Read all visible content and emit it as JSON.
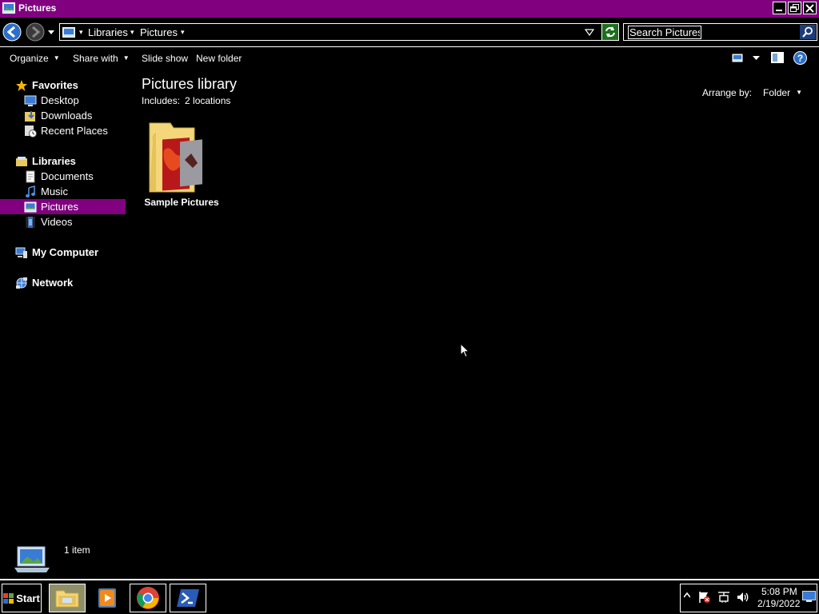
{
  "window": {
    "title": "Pictures",
    "controls": [
      "minimize-icon",
      "restore-icon",
      "close-icon"
    ]
  },
  "address_bar": {
    "breadcrumbs": [
      "Libraries",
      "Pictures"
    ],
    "refresh_icon": "refresh-icon"
  },
  "search": {
    "placeholder": "Search Pictures"
  },
  "command_bar": {
    "organize": "Organize",
    "share_with": "Share with",
    "slide_show": "Slide show",
    "new_folder": "New folder"
  },
  "nav": {
    "favorites": {
      "label": "Favorites",
      "items": [
        "Desktop",
        "Downloads",
        "Recent Places"
      ]
    },
    "libraries": {
      "label": "Libraries",
      "items": [
        "Documents",
        "Music",
        "Pictures",
        "Videos"
      ],
      "selected": "Pictures"
    },
    "computer": "My Computer",
    "network": "Network"
  },
  "content": {
    "title": "Pictures library",
    "includes_label": "Includes:",
    "includes_value": "2 locations",
    "arrange_label": "Arrange by:",
    "arrange_value": "Folder",
    "items": [
      {
        "name": "Sample Pictures",
        "type": "folder"
      }
    ]
  },
  "details": {
    "count": "1 item"
  },
  "taskbar": {
    "start_label": "Start",
    "apps": [
      "file-explorer-icon",
      "media-player-icon",
      "chrome-icon",
      "powershell-icon"
    ],
    "tray_icons": [
      "show-hidden-icons",
      "action-center-flag-icon",
      "network-icon",
      "volume-icon"
    ],
    "time": "5:08 PM",
    "date": "2/19/2022"
  },
  "colors": {
    "accent": "#800080",
    "background": "#000000",
    "text": "#ffffff"
  }
}
